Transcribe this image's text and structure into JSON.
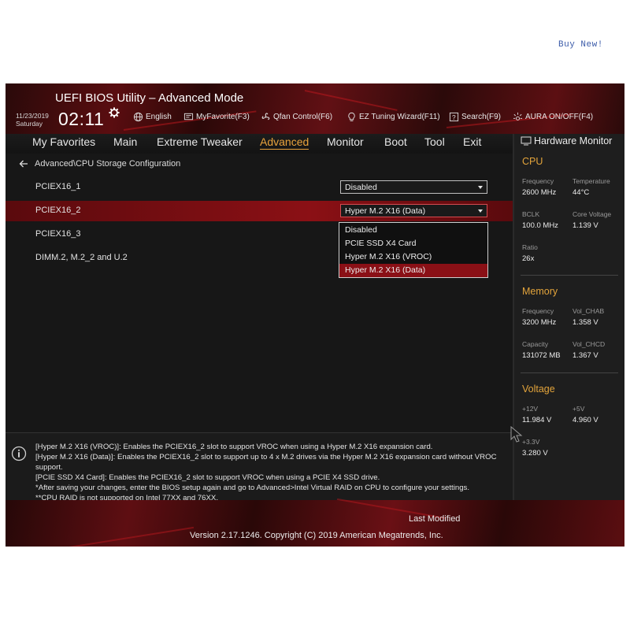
{
  "watermark": "Buy  New!",
  "header": {
    "title": "UEFI BIOS Utility – Advanced Mode",
    "date": "11/23/2019",
    "day": "Saturday",
    "time": "02:11",
    "toolbar": [
      {
        "label": "English",
        "icon": "globe-icon"
      },
      {
        "label": "MyFavorite(F3)",
        "icon": "favorite-icon"
      },
      {
        "label": "Qfan Control(F6)",
        "icon": "fan-icon"
      },
      {
        "label": "EZ Tuning Wizard(F11)",
        "icon": "bulb-icon"
      },
      {
        "label": "Search(F9)",
        "icon": "search-icon"
      },
      {
        "label": "AURA ON/OFF(F4)",
        "icon": "aura-icon"
      }
    ]
  },
  "nav": {
    "tabs": [
      "My Favorites",
      "Main",
      "Extreme Tweaker",
      "Advanced",
      "Monitor",
      "Boot",
      "Tool",
      "Exit"
    ],
    "active": "Advanced"
  },
  "main": {
    "breadcrumb": "Advanced\\CPU Storage Configuration",
    "rows": [
      {
        "label": "PCIEX16_1",
        "value": "Disabled"
      },
      {
        "label": "PCIEX16_2",
        "value": "Hyper M.2 X16 (Data)"
      },
      {
        "label": "PCIEX16_3",
        "value": ""
      },
      {
        "label": "DIMM.2, M.2_2 and U.2",
        "value": ""
      }
    ],
    "dropdown_options": [
      "Disabled",
      "PCIE SSD X4 Card",
      "Hyper M.2 X16 (VROC)",
      "Hyper M.2 X16 (Data)"
    ],
    "dropdown_selected": "Hyper M.2 X16 (Data)"
  },
  "info": {
    "lines": [
      "[Hyper M.2 X16 (VROC)]: Enables the PCIEX16_2 slot to support VROC when using a Hyper M.2 X16 expansion card.",
      "[Hyper M.2 X16 (Data)]: Enables the PCIEX16_2 slot to support up to 4 x M.2 drives via the Hyper M.2 X16 expansion card without VROC",
      "support.",
      "[PCIE SSD X4 Card]: Enables the PCIEX16_2 slot to support VROC when using a PCIE X4 SSD drive.",
      "*After saving your changes, enter the BIOS setup again and go to Advanced>Intel Virtual RAID on CPU to configure your settings.",
      "**CPU RAID is not supported on Intel 77XX and 76XX."
    ]
  },
  "hw": {
    "title": "Hardware Monitor",
    "cpu": {
      "heading": "CPU",
      "frequency_label": "Frequency",
      "frequency": "2600 MHz",
      "temperature_label": "Temperature",
      "temperature": "44°C",
      "bclk_label": "BCLK",
      "bclk": "100.0 MHz",
      "corevoltage_label": "Core Voltage",
      "corevoltage": "1.139 V",
      "ratio_label": "Ratio",
      "ratio": "26x"
    },
    "memory": {
      "heading": "Memory",
      "frequency_label": "Frequency",
      "frequency": "3200 MHz",
      "volchab_label": "Vol_CHAB",
      "volchab": "1.358 V",
      "capacity_label": "Capacity",
      "capacity": "131072 MB",
      "volchcd_label": "Vol_CHCD",
      "volchcd": "1.367 V"
    },
    "voltage": {
      "heading": "Voltage",
      "v12_label": "+12V",
      "v12": "11.984 V",
      "v5_label": "+5V",
      "v5": "4.960 V",
      "v33_label": "+3.3V",
      "v33": "3.280 V"
    }
  },
  "footer": {
    "last_modified": "Last Modified",
    "version": "Version 2.17.1246. Copyright (C) 2019 American Megatrends, Inc."
  },
  "colors": {
    "accent": "#e8a23c",
    "highlight": "#8a1016",
    "header_red": "#5a0d10"
  }
}
